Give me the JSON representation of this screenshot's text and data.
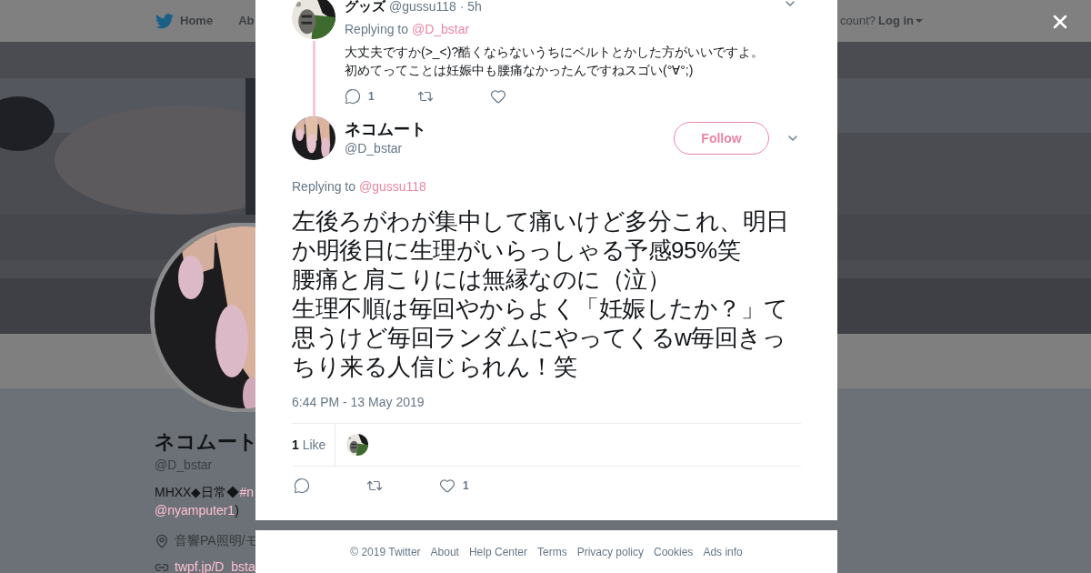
{
  "background_page": {
    "nav": {
      "items": [
        "Home",
        "Ab"
      ],
      "login_prompt": "count?",
      "login": "Log in"
    },
    "profile": {
      "name": "ネコムート",
      "handle": "@D_bstar",
      "bio": [
        {
          "kind": "text",
          "text": "MHXX◆日常◆"
        },
        {
          "kind": "link",
          "text": "#n"
        },
        {
          "kind": "break"
        },
        {
          "kind": "link",
          "text": "@nyamputer1"
        },
        {
          "kind": "text",
          "text": ")"
        }
      ],
      "location": "音響PA照明/モ",
      "website": "twpf.jp/D_bsta"
    }
  },
  "modal": {
    "parent_tweet": {
      "name": "グッズ",
      "handle_line": "@gussu118 · 5h",
      "replying_label": "Replying to",
      "replying_to": "@D_bstar",
      "text_lines": [
        "大丈夫ですか(>_<)?酷くならないうちにベルトとかした方がいいですよ。",
        "初めてってことは妊娠中も腰痛なかったんですねスゴい(°∀°;)"
      ],
      "actions": [
        {
          "kind": "reply",
          "count": "1"
        },
        {
          "kind": "retweet"
        },
        {
          "kind": "like"
        }
      ]
    },
    "tweet": {
      "name": "ネコムート",
      "handle": "@D_bstar",
      "follow_label": "Follow",
      "replying_label": "Replying to",
      "replying_to": "@gussu118",
      "paragraphs": [
        "左後ろがわが集中して痛いけど多分これ、明日か明後日に生理がいらっしゃる予感95%笑",
        "腰痛と肩こりには無縁なのに（泣）",
        "生理不順は毎回やからよく「妊娠したか？」て思うけど毎回ランダムにやってくるw毎回きっちり来る人信じられん！笑"
      ],
      "timestamp": "6:44 PM - 13 May 2019",
      "likes_count": "1",
      "likes_label": "Like",
      "actions": [
        {
          "kind": "reply"
        },
        {
          "kind": "retweet"
        },
        {
          "kind": "like",
          "count": "1"
        }
      ]
    }
  },
  "footer": {
    "links": [
      "© 2019 Twitter",
      "About",
      "Help Center",
      "Terms",
      "Privacy policy",
      "Cookies",
      "Ads info"
    ]
  }
}
